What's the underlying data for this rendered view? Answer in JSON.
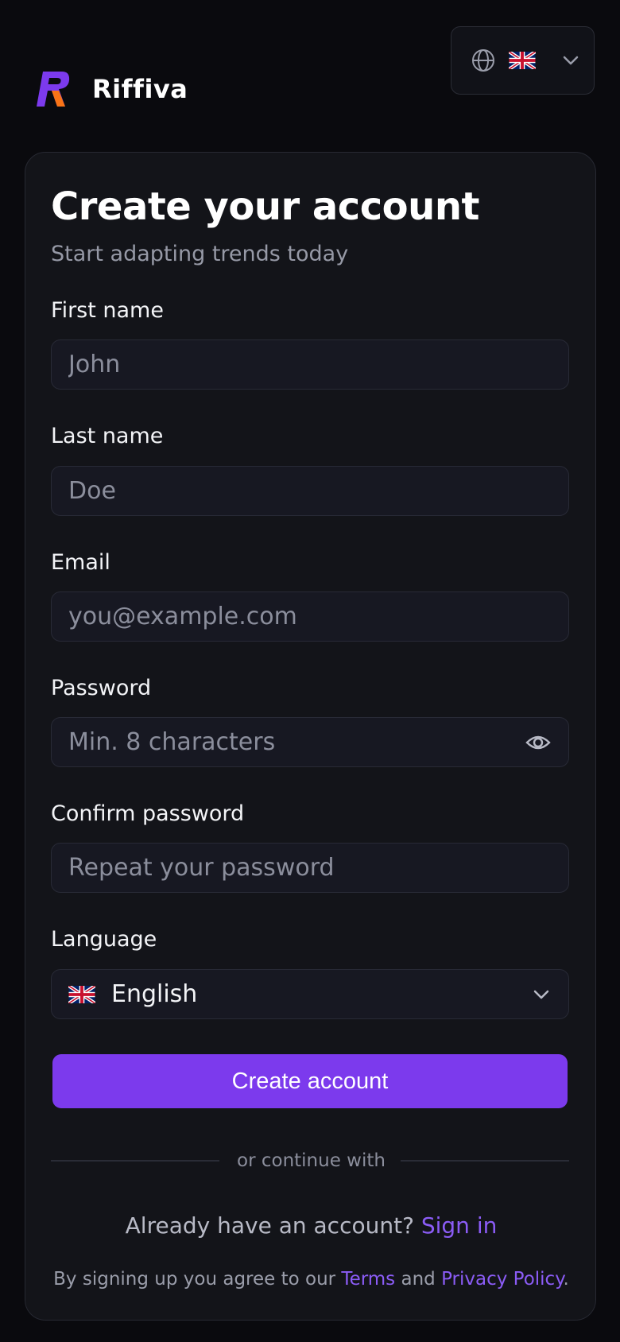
{
  "brand": {
    "name": "Riffiva",
    "mark_colors": {
      "primary": "#7c3aed",
      "accent": "#f97316"
    }
  },
  "lang_switch": {
    "globe_icon": "globe-icon",
    "flag": "uk-flag",
    "chevron_icon": "chevron-down-icon"
  },
  "form": {
    "title": "Create your account",
    "subtitle": "Start adapting trends today",
    "first_name": {
      "label": "First name",
      "placeholder": "John"
    },
    "last_name": {
      "label": "Last name",
      "placeholder": "Doe"
    },
    "email": {
      "label": "Email",
      "placeholder": "you@example.com"
    },
    "password": {
      "label": "Password",
      "placeholder": "Min. 8 characters"
    },
    "confirm_password": {
      "label": "Confirm password",
      "placeholder": "Repeat your password"
    },
    "language": {
      "label": "Language",
      "value": "English"
    },
    "submit_label": "Create account",
    "divider_text": "or continue with"
  },
  "footer": {
    "signin_prompt": "Already have an account?",
    "signin_link": "Sign in",
    "legal_prefix": "By signing up you agree to our",
    "terms_link": "Terms",
    "legal_and": "and",
    "privacy_link": "Privacy Policy",
    "legal_suffix": "."
  },
  "colors": {
    "background": "#0a0a0e",
    "card": "#131419",
    "accent": "#7c3aed",
    "link": "#8b5cf6"
  }
}
